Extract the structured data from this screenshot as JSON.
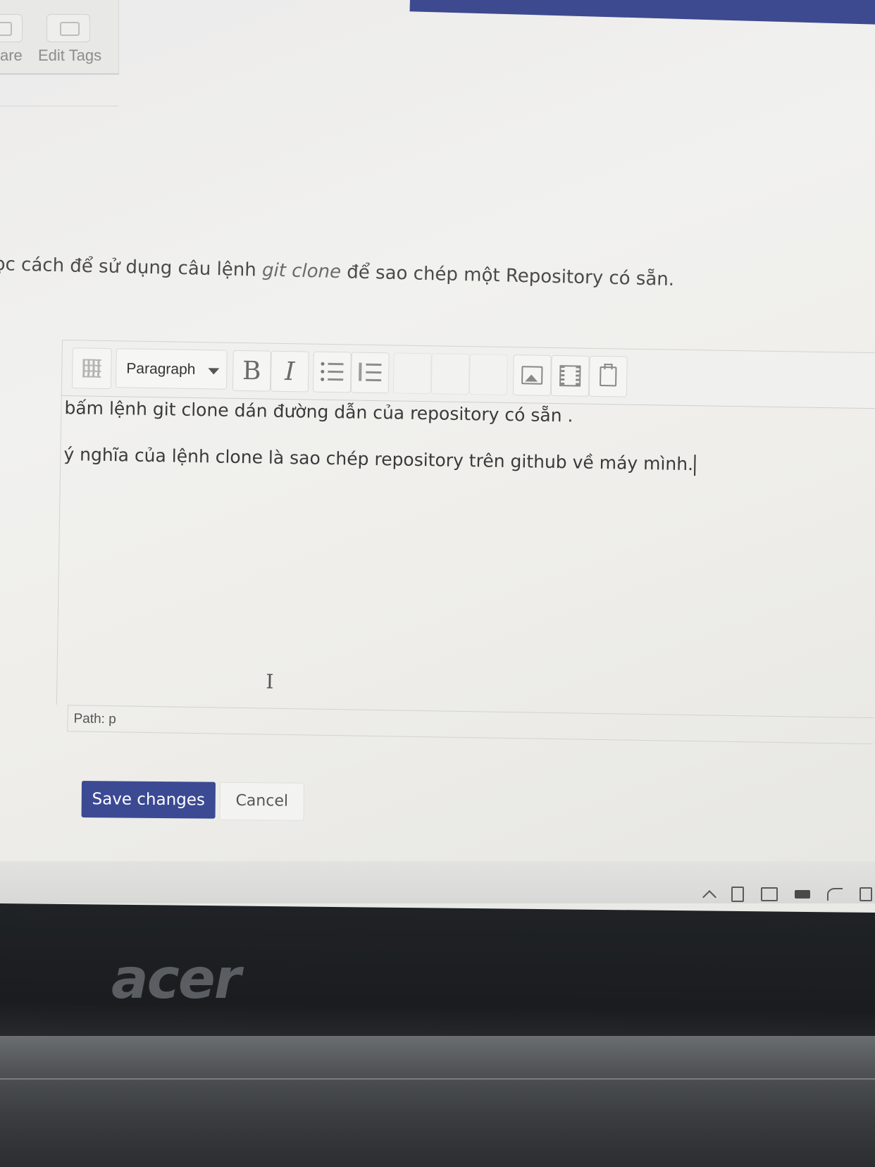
{
  "tag_toolbar": {
    "partial_label": "are",
    "edit_tags_label": "Edit Tags"
  },
  "description": {
    "prefix": "ọc cách để sử dụng câu lệnh ",
    "code": "git clone",
    "suffix": " để sao chép một Repository có sẵn."
  },
  "editor": {
    "format_select_value": "Paragraph",
    "bold_glyph": "B",
    "italic_glyph": "I",
    "content_lines": [
      "bấm lệnh git clone dán đường dẫn của repository có sẵn .",
      "ý nghĩa của lệnh clone là sao chép repository trên github về máy mình."
    ],
    "path_label": "Path: p",
    "cursor_glyph": "I"
  },
  "actions": {
    "save_label": "Save changes",
    "cancel_label": "Cancel"
  },
  "laptop": {
    "brand": "acer"
  },
  "colors": {
    "primary": "#3b4a93",
    "text": "#3a3a3a"
  }
}
